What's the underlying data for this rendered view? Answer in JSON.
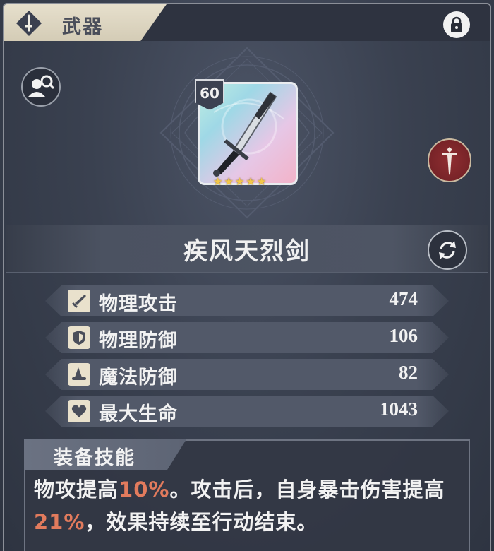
{
  "header": {
    "tab_label": "武器",
    "tab_icon": "sword-emblem-icon",
    "lock_icon": "lock-icon"
  },
  "buttons": {
    "inspect_icon": "magnify-user-icon",
    "class_badge_icon": "sword-badge-icon",
    "swap_icon": "swap-icon"
  },
  "weapon": {
    "level": "60",
    "stars": 5,
    "name": "疾风天烈剑"
  },
  "stats": [
    {
      "label": "物理攻击",
      "value": "474",
      "icon": "sword-stat-icon"
    },
    {
      "label": "物理防御",
      "value": "106",
      "icon": "shield-stat-icon"
    },
    {
      "label": "魔法防御",
      "value": "82",
      "icon": "wizard-hat-icon"
    },
    {
      "label": "最大生命",
      "value": "1043",
      "icon": "heart-icon"
    }
  ],
  "skill": {
    "title": "装备技能",
    "part1": "物攻提高",
    "hl1": "10%",
    "part2": "。攻击后，自身暴击伤害提高",
    "hl2": "21%",
    "part3": "，效果持续至行动结束。"
  },
  "colors": {
    "highlight": "#e27b5d",
    "tab_bg": "#e6dfcc",
    "badge_red": "#8f2e31"
  }
}
